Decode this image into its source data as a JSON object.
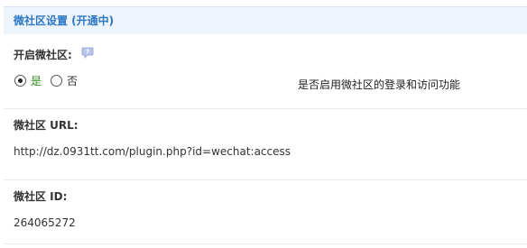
{
  "section": {
    "title": "微社区设置 (开通中)"
  },
  "enable": {
    "label": "开启微社区:",
    "options": [
      {
        "label": "是",
        "checked": true
      },
      {
        "label": "否",
        "checked": false
      }
    ],
    "hint": "是否启用微社区的登录和访问功能"
  },
  "url": {
    "label": "微社区 URL:",
    "value": "http://dz.0931tt.com/plugin.php?id=wechat:access"
  },
  "id_field": {
    "label": "微社区 ID:",
    "value": "264065272"
  },
  "icons": {
    "help": "help-bubble-icon"
  },
  "colors": {
    "header_bg": "#eef4fb",
    "header_text": "#2b78c5",
    "yes_text": "#2e8b1f"
  }
}
